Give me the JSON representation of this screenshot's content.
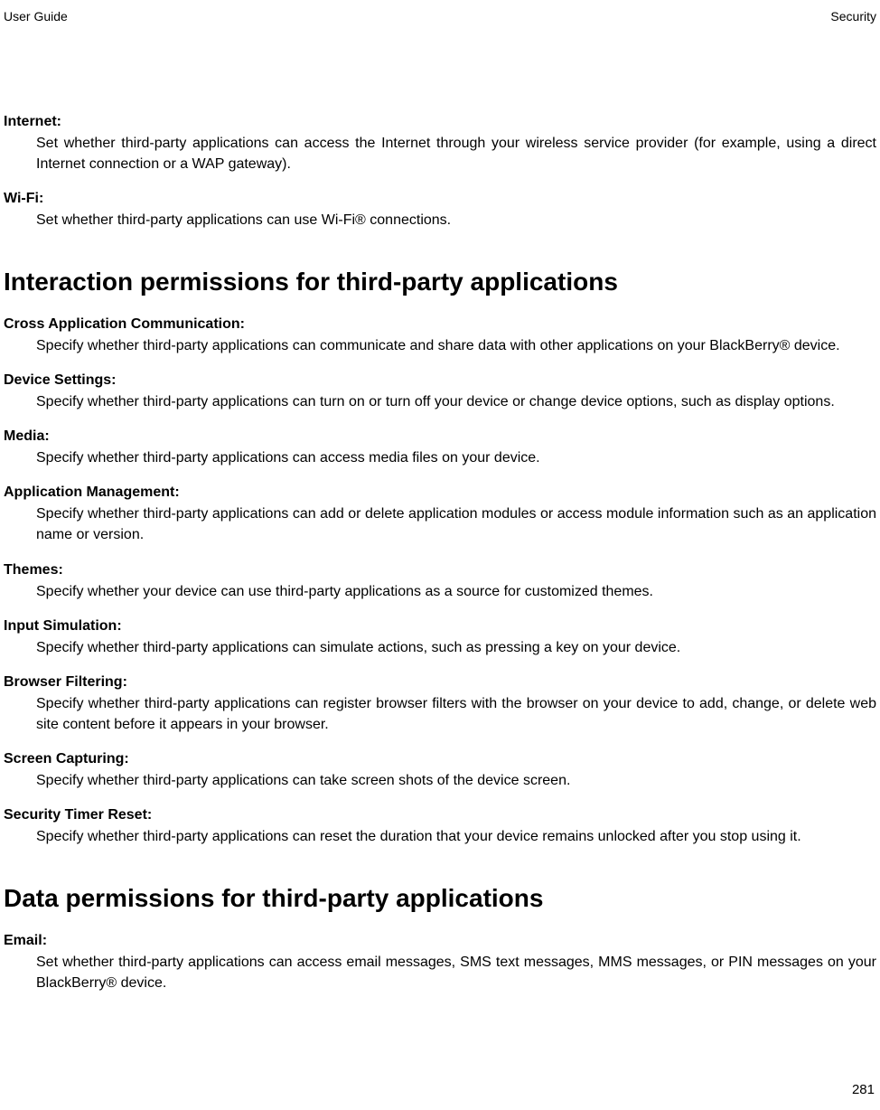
{
  "header": {
    "left": "User Guide",
    "right": "Security"
  },
  "section1_items": [
    {
      "term": "Internet:",
      "desc": "Set whether third-party applications can access the Internet through your wireless service provider (for example, using a direct Internet connection or a WAP gateway)."
    },
    {
      "term": "Wi-Fi:",
      "desc": "Set whether third-party applications can use Wi-Fi® connections."
    }
  ],
  "section2_title": "Interaction permissions for third-party applications",
  "section2_items": [
    {
      "term": "Cross Application Communication:",
      "desc": "Specify whether third-party applications can communicate and share data with other applications on your BlackBerry® device."
    },
    {
      "term": "Device Settings:",
      "desc": "Specify whether third-party applications can turn on or turn off your device or change device options, such as display options."
    },
    {
      "term": "Media:",
      "desc": "Specify whether third-party applications can access media files on your device."
    },
    {
      "term": "Application Management:",
      "desc": "Specify whether third-party applications can add or delete application modules or access module information such as an application name or version."
    },
    {
      "term": "Themes:",
      "desc": "Specify whether your device can use third-party applications as a source for customized themes."
    },
    {
      "term": "Input Simulation:",
      "desc": "Specify whether third-party applications can simulate actions, such as pressing a key on your device."
    },
    {
      "term": "Browser Filtering:",
      "desc": "Specify whether third-party applications can register browser filters with the browser on your device to add, change, or delete web site content before it appears in your browser."
    },
    {
      "term": "Screen Capturing:",
      "desc": "Specify whether third-party applications can take screen shots of the device screen."
    },
    {
      "term": "Security Timer Reset:",
      "desc": "Specify whether third-party applications can reset the duration that your device remains unlocked after you stop using it."
    }
  ],
  "section3_title": "Data permissions for third-party applications",
  "section3_items": [
    {
      "term": "Email:",
      "desc": "Set whether third-party applications can access email messages, SMS text messages, MMS messages, or PIN messages on your BlackBerry® device."
    }
  ],
  "page_number": "281"
}
